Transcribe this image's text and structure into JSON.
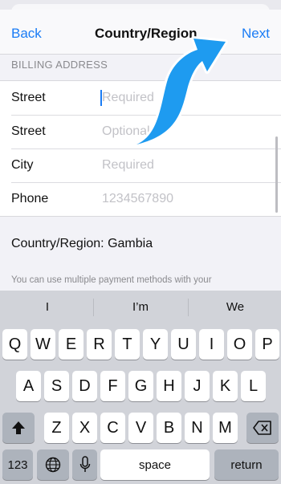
{
  "nav": {
    "back": "Back",
    "title": "Country/Region",
    "next": "Next"
  },
  "section": {
    "label": "BILLING ADDRESS"
  },
  "form": {
    "rows": [
      {
        "label": "Street",
        "placeholder": "Required"
      },
      {
        "label": "Street",
        "placeholder": "Optional"
      },
      {
        "label": "City",
        "placeholder": "Required"
      },
      {
        "label": "Phone",
        "placeholder": "1234567890"
      }
    ]
  },
  "country": "Country/Region: Gambia",
  "info": "You can use multiple payment methods with your",
  "keyboard": {
    "suggestions": [
      "I",
      "I’m",
      "We"
    ],
    "row1": [
      "Q",
      "W",
      "E",
      "R",
      "T",
      "Y",
      "U",
      "I",
      "O",
      "P"
    ],
    "row2": [
      "A",
      "S",
      "D",
      "F",
      "G",
      "H",
      "J",
      "K",
      "L"
    ],
    "row3": [
      "Z",
      "X",
      "C",
      "V",
      "B",
      "N",
      "M"
    ],
    "numbers": "123",
    "space": "space",
    "return": "return"
  },
  "colors": {
    "accent": "#1a7cf5",
    "arrow": "#1e9bf0"
  }
}
